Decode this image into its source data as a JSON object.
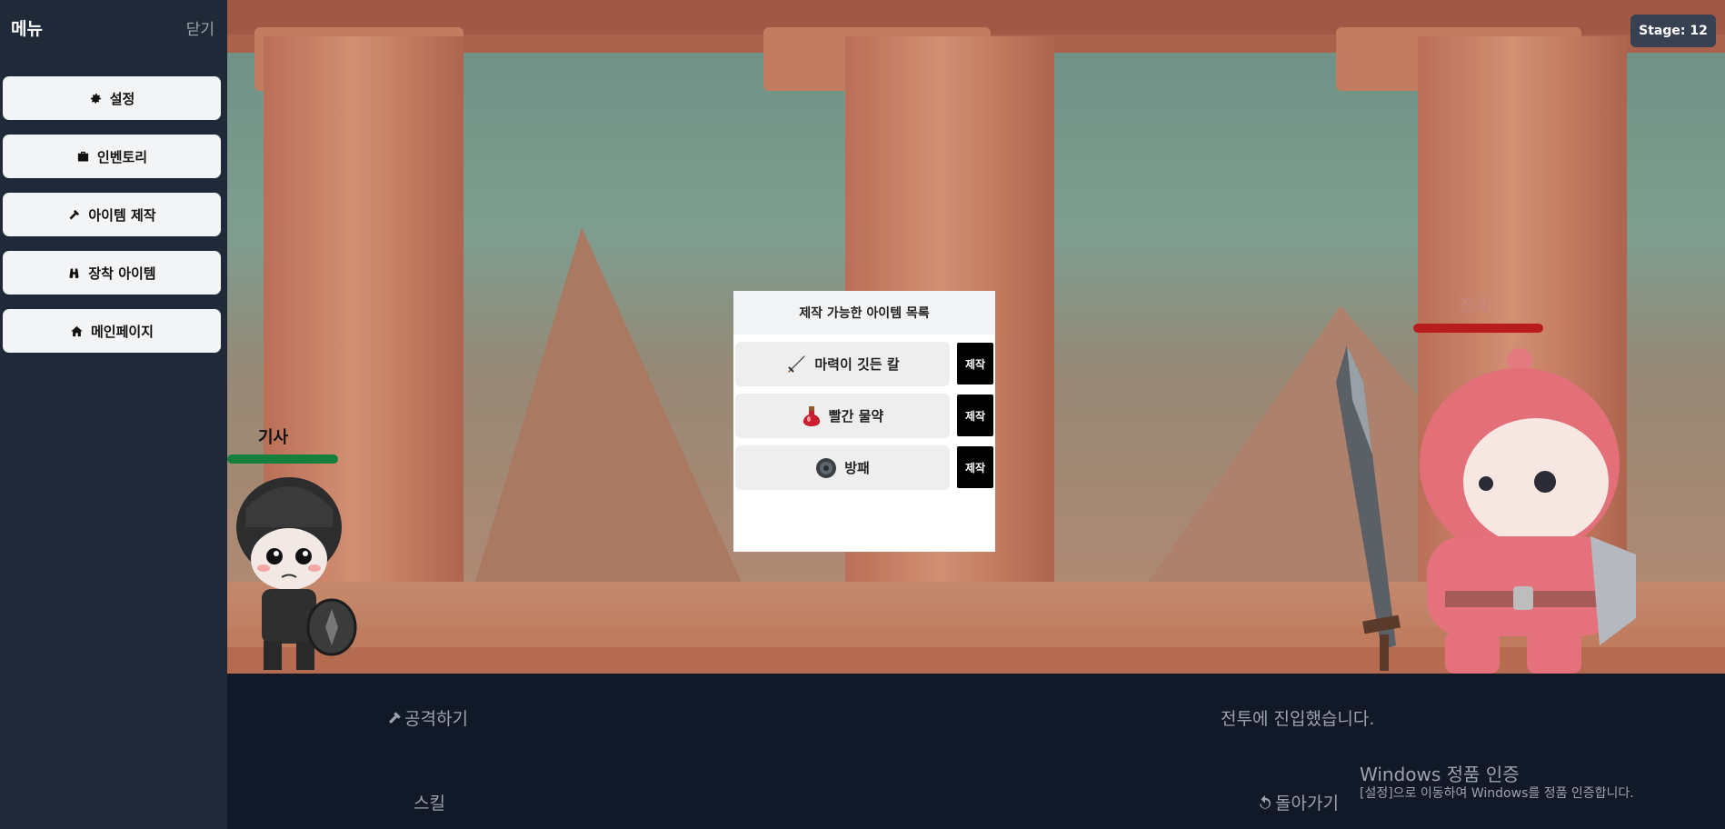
{
  "sidebar": {
    "title": "메뉴",
    "close_label": "닫기",
    "items": [
      {
        "label": "설정",
        "icon": "gear-icon"
      },
      {
        "label": "인벤토리",
        "icon": "briefcase-icon"
      },
      {
        "label": "아이템 제작",
        "icon": "hammer-icon"
      },
      {
        "label": "장착 아이템",
        "icon": "binoculars-icon"
      },
      {
        "label": "메인페이지",
        "icon": "home-icon"
      }
    ]
  },
  "stage": {
    "label": "Stage: 12"
  },
  "player": {
    "name": "기사",
    "hp_color": "#15803d",
    "hp_fraction": 1.0
  },
  "enemy": {
    "name": "전사",
    "hp_color": "#b91c1c",
    "hp_fraction": 1.0
  },
  "craft_dialog": {
    "title": "제작 가능한 아이템 목록",
    "items": [
      {
        "name": "마력이 깃든 칼",
        "icon": "sword-icon",
        "button": "제작"
      },
      {
        "name": "빨간 물약",
        "icon": "potion-icon",
        "button": "제작"
      },
      {
        "name": "방패",
        "icon": "shield-icon",
        "button": "제작"
      }
    ]
  },
  "bottom": {
    "attack_label": "공격하기",
    "skill_label": "스킬",
    "battle_log": "전투에 진입했습니다.",
    "back_label": "돌아가기"
  },
  "watermark": {
    "title": "Windows 정품 인증",
    "subtitle": "[설정]으로 이동하여 Windows를 정품 인증합니다."
  }
}
